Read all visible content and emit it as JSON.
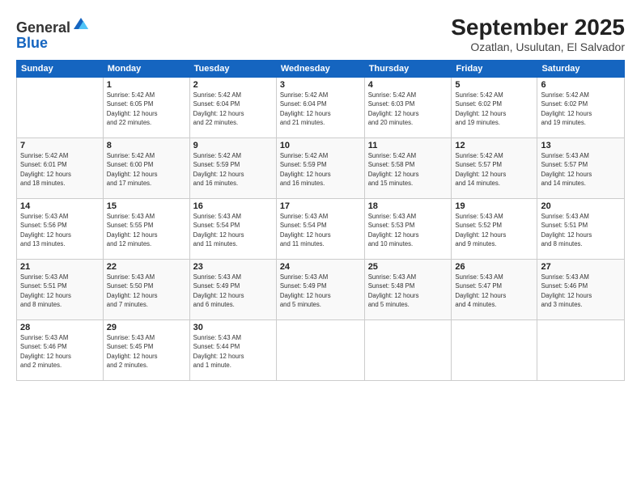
{
  "header": {
    "logo_line1": "General",
    "logo_line2": "Blue",
    "month": "September 2025",
    "location": "Ozatlan, Usulutan, El Salvador"
  },
  "days_of_week": [
    "Sunday",
    "Monday",
    "Tuesday",
    "Wednesday",
    "Thursday",
    "Friday",
    "Saturday"
  ],
  "weeks": [
    [
      {
        "day": "",
        "info": ""
      },
      {
        "day": "1",
        "info": "Sunrise: 5:42 AM\nSunset: 6:05 PM\nDaylight: 12 hours\nand 22 minutes."
      },
      {
        "day": "2",
        "info": "Sunrise: 5:42 AM\nSunset: 6:04 PM\nDaylight: 12 hours\nand 22 minutes."
      },
      {
        "day": "3",
        "info": "Sunrise: 5:42 AM\nSunset: 6:04 PM\nDaylight: 12 hours\nand 21 minutes."
      },
      {
        "day": "4",
        "info": "Sunrise: 5:42 AM\nSunset: 6:03 PM\nDaylight: 12 hours\nand 20 minutes."
      },
      {
        "day": "5",
        "info": "Sunrise: 5:42 AM\nSunset: 6:02 PM\nDaylight: 12 hours\nand 19 minutes."
      },
      {
        "day": "6",
        "info": "Sunrise: 5:42 AM\nSunset: 6:02 PM\nDaylight: 12 hours\nand 19 minutes."
      }
    ],
    [
      {
        "day": "7",
        "info": "Sunrise: 5:42 AM\nSunset: 6:01 PM\nDaylight: 12 hours\nand 18 minutes."
      },
      {
        "day": "8",
        "info": "Sunrise: 5:42 AM\nSunset: 6:00 PM\nDaylight: 12 hours\nand 17 minutes."
      },
      {
        "day": "9",
        "info": "Sunrise: 5:42 AM\nSunset: 5:59 PM\nDaylight: 12 hours\nand 16 minutes."
      },
      {
        "day": "10",
        "info": "Sunrise: 5:42 AM\nSunset: 5:59 PM\nDaylight: 12 hours\nand 16 minutes."
      },
      {
        "day": "11",
        "info": "Sunrise: 5:42 AM\nSunset: 5:58 PM\nDaylight: 12 hours\nand 15 minutes."
      },
      {
        "day": "12",
        "info": "Sunrise: 5:42 AM\nSunset: 5:57 PM\nDaylight: 12 hours\nand 14 minutes."
      },
      {
        "day": "13",
        "info": "Sunrise: 5:43 AM\nSunset: 5:57 PM\nDaylight: 12 hours\nand 14 minutes."
      }
    ],
    [
      {
        "day": "14",
        "info": "Sunrise: 5:43 AM\nSunset: 5:56 PM\nDaylight: 12 hours\nand 13 minutes."
      },
      {
        "day": "15",
        "info": "Sunrise: 5:43 AM\nSunset: 5:55 PM\nDaylight: 12 hours\nand 12 minutes."
      },
      {
        "day": "16",
        "info": "Sunrise: 5:43 AM\nSunset: 5:54 PM\nDaylight: 12 hours\nand 11 minutes."
      },
      {
        "day": "17",
        "info": "Sunrise: 5:43 AM\nSunset: 5:54 PM\nDaylight: 12 hours\nand 11 minutes."
      },
      {
        "day": "18",
        "info": "Sunrise: 5:43 AM\nSunset: 5:53 PM\nDaylight: 12 hours\nand 10 minutes."
      },
      {
        "day": "19",
        "info": "Sunrise: 5:43 AM\nSunset: 5:52 PM\nDaylight: 12 hours\nand 9 minutes."
      },
      {
        "day": "20",
        "info": "Sunrise: 5:43 AM\nSunset: 5:51 PM\nDaylight: 12 hours\nand 8 minutes."
      }
    ],
    [
      {
        "day": "21",
        "info": "Sunrise: 5:43 AM\nSunset: 5:51 PM\nDaylight: 12 hours\nand 8 minutes."
      },
      {
        "day": "22",
        "info": "Sunrise: 5:43 AM\nSunset: 5:50 PM\nDaylight: 12 hours\nand 7 minutes."
      },
      {
        "day": "23",
        "info": "Sunrise: 5:43 AM\nSunset: 5:49 PM\nDaylight: 12 hours\nand 6 minutes."
      },
      {
        "day": "24",
        "info": "Sunrise: 5:43 AM\nSunset: 5:49 PM\nDaylight: 12 hours\nand 5 minutes."
      },
      {
        "day": "25",
        "info": "Sunrise: 5:43 AM\nSunset: 5:48 PM\nDaylight: 12 hours\nand 5 minutes."
      },
      {
        "day": "26",
        "info": "Sunrise: 5:43 AM\nSunset: 5:47 PM\nDaylight: 12 hours\nand 4 minutes."
      },
      {
        "day": "27",
        "info": "Sunrise: 5:43 AM\nSunset: 5:46 PM\nDaylight: 12 hours\nand 3 minutes."
      }
    ],
    [
      {
        "day": "28",
        "info": "Sunrise: 5:43 AM\nSunset: 5:46 PM\nDaylight: 12 hours\nand 2 minutes."
      },
      {
        "day": "29",
        "info": "Sunrise: 5:43 AM\nSunset: 5:45 PM\nDaylight: 12 hours\nand 2 minutes."
      },
      {
        "day": "30",
        "info": "Sunrise: 5:43 AM\nSunset: 5:44 PM\nDaylight: 12 hours\nand 1 minute."
      },
      {
        "day": "",
        "info": ""
      },
      {
        "day": "",
        "info": ""
      },
      {
        "day": "",
        "info": ""
      },
      {
        "day": "",
        "info": ""
      }
    ]
  ]
}
